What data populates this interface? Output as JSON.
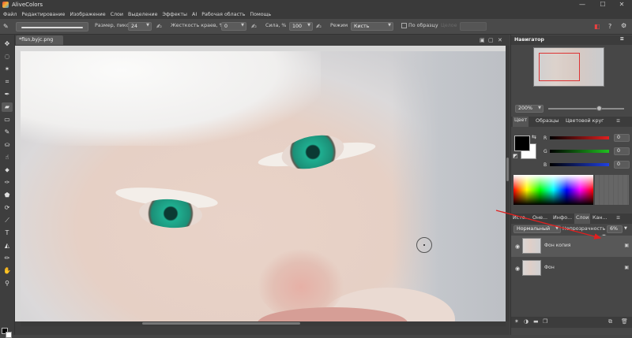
{
  "app": {
    "title": "AliveColors"
  },
  "menu": [
    "Файл",
    "Редактирование",
    "Изображение",
    "Слои",
    "Выделение",
    "Эффекты",
    "AI",
    "Рабочая область",
    "Помощь"
  ],
  "options": {
    "size_label": "Размер, пикс",
    "size_value": "24",
    "hardness_label": "Жесткость краев, %",
    "hardness_value": "0",
    "strength_label": "Сила, %",
    "strength_value": "100",
    "mode_label": "Режим",
    "mode_value": "Кисть",
    "sample_label": "По образцу",
    "sample_disabled": "Целое"
  },
  "document": {
    "tab_title": "*flsn,byjc.png"
  },
  "navigator": {
    "title": "Навигатор",
    "zoom": "200%"
  },
  "color_panel": {
    "tabs": [
      "Цвет",
      "Образцы",
      "Цветовой круг"
    ],
    "channels": [
      {
        "label": "R",
        "value": "0",
        "color": "#e02020"
      },
      {
        "label": "G",
        "value": "0",
        "color": "#20c020"
      },
      {
        "label": "B",
        "value": "0",
        "color": "#2040e0"
      }
    ]
  },
  "layers_panel": {
    "tabs": [
      "Исто...",
      "Оне...",
      "Инфо...",
      "Слои",
      "Кан..."
    ],
    "blend_mode": "Нормальный",
    "opacity_label": "Непрозрачность",
    "opacity_value": "6%",
    "layers": [
      {
        "name": "Фон копия",
        "selected": true
      },
      {
        "name": "Фон",
        "selected": false
      }
    ]
  },
  "colors": {
    "arrow": "#e02020",
    "accent": "#d33333"
  }
}
